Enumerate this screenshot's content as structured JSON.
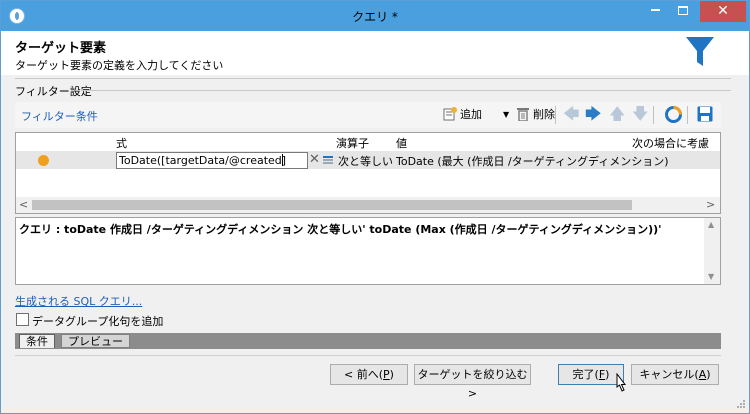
{
  "window": {
    "title": "クエリ *"
  },
  "header": {
    "title": "ターゲット要素",
    "subtitle": "ターゲット要素の定義を入力してください"
  },
  "filter_group": {
    "label": "フィルター設定"
  },
  "toolbar": {
    "link": "フィルター条件",
    "add_label": "追加",
    "delete_label": "削除"
  },
  "grid": {
    "columns": {
      "expression": "式",
      "operator": "演算子",
      "value": "値",
      "consider": "次の場合に考慮"
    },
    "rows": [
      {
        "expression": "ToDate([targetData/@created]",
        "operator": "次と等しい",
        "value": "ToDate (最大 (作成日 /ターゲティングディメンション)"
      }
    ]
  },
  "query": {
    "text": "クエリ : toDate 作成日 /ターゲティングディメンション 次と等しい' toDate (Max (作成日 /ターゲティングディメンション))'"
  },
  "sql_link": "生成される SQL クエリ...",
  "checkbox": {
    "label": "データグループ化句を追加"
  },
  "tabs": [
    {
      "label": "条件"
    },
    {
      "label": "プレビュー"
    }
  ],
  "buttons": {
    "prev": {
      "label": "< 前へ(",
      "key": "P",
      "end": ")"
    },
    "narrow": {
      "label": "ターゲットを絞り込む>"
    },
    "finish": {
      "label": "完了(",
      "key": "F",
      "end": ")"
    },
    "cancel": {
      "label": "キャンセル(",
      "key": "A",
      "end": ")"
    }
  },
  "colors": {
    "titlebar": "#4aa0df",
    "close": "#c75050",
    "link": "#1e5fb4",
    "accent_blue": "#2a7cc7",
    "row_dot": "#f0a020"
  }
}
